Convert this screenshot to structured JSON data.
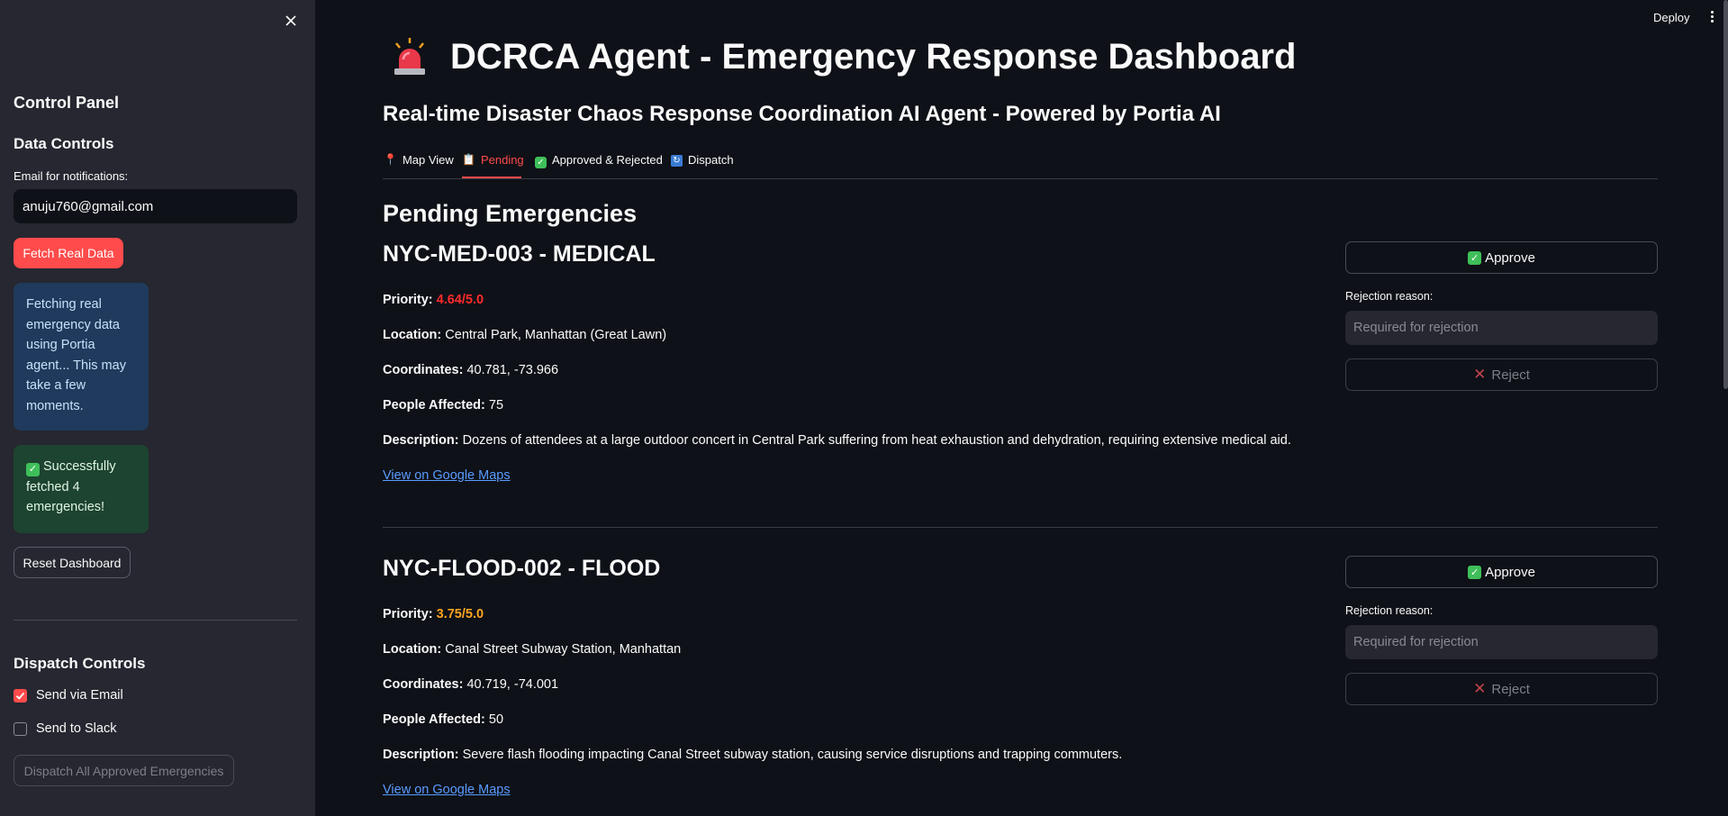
{
  "header": {
    "deploy_label": "Deploy"
  },
  "sidebar": {
    "control_panel": "Control Panel",
    "data_controls": "Data Controls",
    "email_label": "Email for notifications:",
    "email_value": "anuju760@gmail.com",
    "fetch_label": "Fetch Real Data",
    "info_message": "Fetching real emergency data using Portia agent... This may take a few moments.",
    "success_message": "Successfully fetched 4 emergencies!",
    "reset_label": "Reset Dashboard",
    "dispatch_controls": "Dispatch Controls",
    "send_email_label": "Send via Email",
    "send_email_checked": true,
    "send_slack_label": "Send to Slack",
    "send_slack_checked": false,
    "dispatch_all_label": "Dispatch All Approved Emergencies"
  },
  "main": {
    "title": "DCRCA Agent - Emergency Response Dashboard",
    "subtitle": "Real-time Disaster Chaos Response Coordination AI Agent - Powered by Portia AI",
    "tabs": [
      {
        "label": "Map View",
        "icon": "pin-icon",
        "active": false
      },
      {
        "label": "Pending",
        "icon": "clipboard-icon",
        "active": true
      },
      {
        "label": "Approved & Rejected",
        "icon": "check-icon",
        "active": false
      },
      {
        "label": "Dispatch",
        "icon": "refresh-icon",
        "active": false
      }
    ],
    "section_title": "Pending Emergencies",
    "field_labels": {
      "priority": "Priority:",
      "location": "Location:",
      "coordinates": "Coordinates:",
      "people": "People Affected:",
      "description": "Description:"
    },
    "emergencies": [
      {
        "title": "NYC-MED-003 - MEDICAL",
        "priority": "4.64/5.0",
        "priority_color": "#ff2b2b",
        "location": "Central Park, Manhattan (Great Lawn)",
        "coordinates": "40.781, -73.966",
        "people_affected": "75",
        "description": "Dozens of attendees at a large outdoor concert in Central Park suffering from heat exhaustion and dehydration, requiring extensive medical aid.",
        "map_link": "View on Google Maps",
        "approve_label": "Approve",
        "rejection_label": "Rejection reason:",
        "rejection_placeholder": "Required for rejection",
        "reject_label": "Reject"
      },
      {
        "title": "NYC-FLOOD-002 - FLOOD",
        "priority": "3.75/5.0",
        "priority_color": "#ffa421",
        "location": "Canal Street Subway Station, Manhattan",
        "coordinates": "40.719, -74.001",
        "people_affected": "50",
        "description": "Severe flash flooding impacting Canal Street subway station, causing service disruptions and trapping commuters.",
        "map_link": "View on Google Maps",
        "approve_label": "Approve",
        "rejection_label": "Rejection reason:",
        "rejection_placeholder": "Required for rejection",
        "reject_label": "Reject"
      }
    ]
  }
}
